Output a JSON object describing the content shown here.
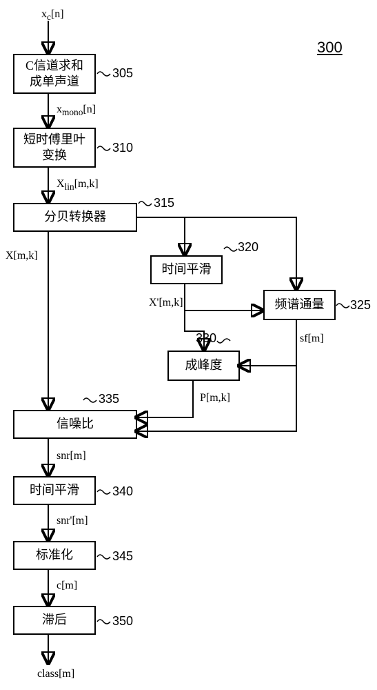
{
  "diagram_ref": "300",
  "input_signal": "xc[n]",
  "signals": {
    "xc": "x",
    "xc_sub": "c",
    "xc_idx": "[n]",
    "xmono": "x",
    "xmono_sub": "mono",
    "xmono_idx": "[n]",
    "Xlin": "X",
    "Xlin_sub": "lin",
    "Xlin_idx": "[m,k]",
    "Xmk": "X[m,k]",
    "Xprime": "X'[m,k]",
    "sf": "sf[m]",
    "Pmk": "P[m,k]",
    "snr": "snr[m]",
    "snrprime": "snr'[m]",
    "cm": "c[m]",
    "classm": "class[m]"
  },
  "blocks": {
    "b305": {
      "label": "C信道求和成单声道",
      "ref": "305"
    },
    "b310": {
      "label": "短时傅里叶变换",
      "ref": "310"
    },
    "b315": {
      "label": "分贝转换器",
      "ref": "315"
    },
    "b320": {
      "label": "时间平滑",
      "ref": "320"
    },
    "b325": {
      "label": "频谱通量",
      "ref": "325"
    },
    "b330": {
      "label": "成峰度",
      "ref": "330"
    },
    "b335": {
      "label": "信噪比",
      "ref": "335"
    },
    "b340": {
      "label": "时间平滑",
      "ref": "340"
    },
    "b345": {
      "label": "标准化",
      "ref": "345"
    },
    "b350": {
      "label": "滞后",
      "ref": "350"
    }
  }
}
